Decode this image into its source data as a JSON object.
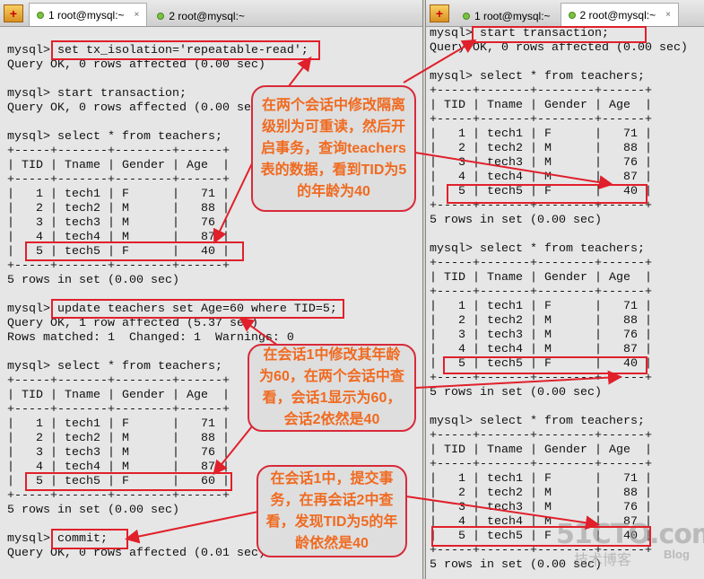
{
  "left_window": {
    "tabs": [
      {
        "label": "1 root@mysql:~",
        "active": true,
        "close": "×"
      },
      {
        "label": "2 root@mysql:~",
        "active": false
      }
    ],
    "lines": [
      "",
      "mysql> set tx_isolation='repeatable-read';",
      "Query OK, 0 rows affected (0.00 sec)",
      "",
      "mysql> start transaction;",
      "Query OK, 0 rows affected (0.00 sec)",
      "",
      "mysql> select * from teachers;",
      "+-----+-------+--------+------+",
      "| TID | Tname | Gender | Age  |",
      "+-----+-------+--------+------+",
      "|   1 | tech1 | F      |   71 |",
      "|   2 | tech2 | M      |   88 |",
      "|   3 | tech3 | M      |   76 |",
      "|   4 | tech4 | M      |   87 |",
      "|   5 | tech5 | F      |   40 |",
      "+-----+-------+--------+------+",
      "5 rows in set (0.00 sec)",
      "",
      "mysql> update teachers set Age=60 where TID=5;",
      "Query OK, 1 row affected (5.37 sec)",
      "Rows matched: 1  Changed: 1  Warnings: 0",
      "",
      "mysql> select * from teachers;",
      "+-----+-------+--------+------+",
      "| TID | Tname | Gender | Age  |",
      "+-----+-------+--------+------+",
      "|   1 | tech1 | F      |   71 |",
      "|   2 | tech2 | M      |   88 |",
      "|   3 | tech3 | M      |   76 |",
      "|   4 | tech4 | M      |   87 |",
      "|   5 | tech5 | F      |   60 |",
      "+-----+-------+--------+------+",
      "5 rows in set (0.00 sec)",
      "",
      "mysql> commit;",
      "Query OK, 0 rows affected (0.01 sec)"
    ]
  },
  "right_window": {
    "tabs": [
      {
        "label": "1 root@mysql:~",
        "active": false
      },
      {
        "label": "2 root@mysql:~",
        "active": true,
        "close": "×"
      }
    ],
    "lines": [
      "mysql> start transaction;",
      "Query OK, 0 rows affected (0.00 sec)",
      "",
      "mysql> select * from teachers;",
      "+-----+-------+--------+------+",
      "| TID | Tname | Gender | Age  |",
      "+-----+-------+--------+------+",
      "|   1 | tech1 | F      |   71 |",
      "|   2 | tech2 | M      |   88 |",
      "|   3 | tech3 | M      |   76 |",
      "|   4 | tech4 | M      |   87 |",
      "|   5 | tech5 | F      |   40 |",
      "+-----+-------+--------+------+",
      "5 rows in set (0.00 sec)",
      "",
      "mysql> select * from teachers;",
      "+-----+-------+--------+------+",
      "| TID | Tname | Gender | Age  |",
      "+-----+-------+--------+------+",
      "|   1 | tech1 | F      |   71 |",
      "|   2 | tech2 | M      |   88 |",
      "|   3 | tech3 | M      |   76 |",
      "|   4 | tech4 | M      |   87 |",
      "|   5 | tech5 | F      |   40 |",
      "+-----+-------+--------+------+",
      "5 rows in set (0.00 sec)",
      "",
      "mysql> select * from teachers;",
      "+-----+-------+--------+------+",
      "| TID | Tname | Gender | Age  |",
      "+-----+-------+--------+------+",
      "|   1 | tech1 | F      |   71 |",
      "|   2 | tech2 | M      |   88 |",
      "|   3 | tech3 | M      |   76 |",
      "|   4 | tech4 | M      |   87 |",
      "|   5 | tech5 | F      |   40 |",
      "+-----+-------+--------+------+",
      "5 rows in set (0.00 sec)"
    ]
  },
  "annotations": [
    "在两个会话中修改隔离级别为可重读，然后开启事务，查询teachers表的数据，看到TID为5的年龄为40",
    "在会话1中修改其年龄为60，在两个会话中查看，会话1显示为60，会话2依然是40",
    "在会话1中，提交事务，在再会话2中查看，发现TID为5的年龄依然是40"
  ],
  "watermark": {
    "main": "51CTO.com",
    "sub": "技术博客",
    "blog": "Blog"
  },
  "colors": {
    "annotation_border": "#e0202a",
    "annotation_text": "#f06a20",
    "terminal_bg": "#e6e6e6"
  }
}
